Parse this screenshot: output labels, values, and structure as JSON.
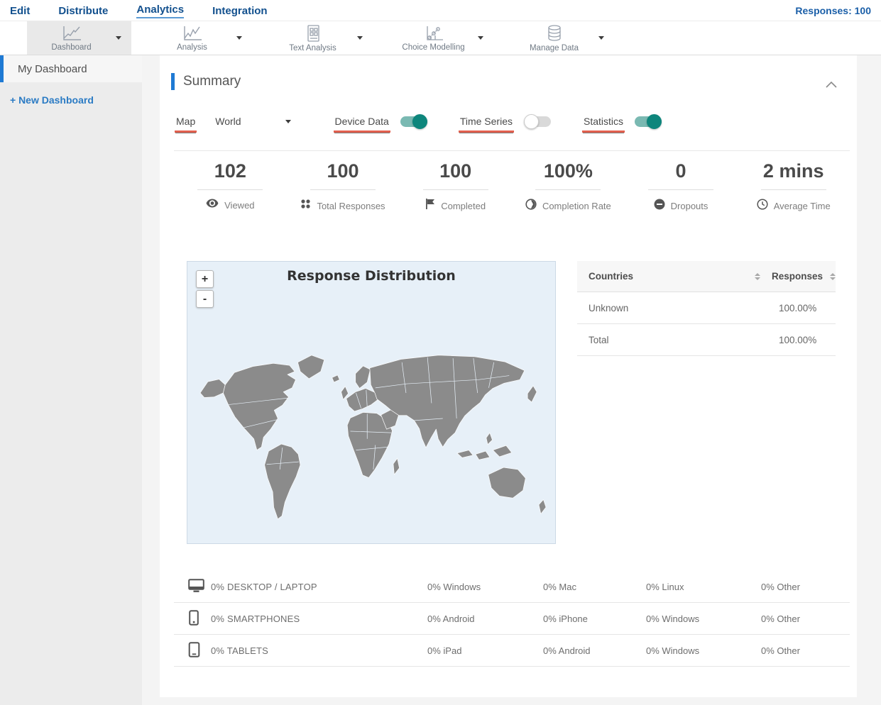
{
  "nav": {
    "items": [
      {
        "label": "Edit",
        "active": false
      },
      {
        "label": "Distribute",
        "active": false
      },
      {
        "label": "Analytics",
        "active": true
      },
      {
        "label": "Integration",
        "active": false
      }
    ],
    "responses_label": "Responses: 100"
  },
  "toolbar": {
    "items": [
      {
        "label": "Dashboard",
        "icon": "line-chart-icon",
        "selected": true
      },
      {
        "label": "Analysis",
        "icon": "line-chart-icon",
        "selected": false
      },
      {
        "label": "Text Analysis",
        "icon": "document-grid-icon",
        "selected": false
      },
      {
        "label": "Choice Modelling",
        "icon": "scatter-chart-icon",
        "selected": false
      },
      {
        "label": "Manage Data",
        "icon": "database-icon",
        "selected": false
      }
    ]
  },
  "sidebar": {
    "selected_item": "My Dashboard",
    "new_dashboard_label": "+ New Dashboard"
  },
  "summary": {
    "title": "Summary",
    "controls": {
      "map_label": "Map",
      "map_value": "World",
      "device_data_label": "Device Data",
      "device_data_on": true,
      "time_series_label": "Time Series",
      "time_series_on": false,
      "statistics_label": "Statistics",
      "statistics_on": true
    },
    "stats": [
      {
        "value": "102",
        "label": "Viewed",
        "icon": "eye-icon"
      },
      {
        "value": "100",
        "label": "Total Responses",
        "icon": "dots-grid-icon"
      },
      {
        "value": "100",
        "label": "Completed",
        "icon": "flag-icon"
      },
      {
        "value": "100%",
        "label": "Completion Rate",
        "icon": "contrast-icon"
      },
      {
        "value": "0",
        "label": "Dropouts",
        "icon": "minus-circle-icon"
      },
      {
        "value": "2 mins",
        "label": "Average Time",
        "icon": "clock-icon"
      }
    ],
    "map": {
      "title": "Response Distribution",
      "zoom_in": "+",
      "zoom_out": "-"
    },
    "countries_table": {
      "columns": [
        "Countries",
        "Responses"
      ],
      "rows": [
        {
          "name": "Unknown",
          "value": "100.00%"
        },
        {
          "name": "Total",
          "value": "100.00%"
        }
      ]
    },
    "device_table": {
      "rows": [
        {
          "icon": "desktop-icon",
          "category": "0% DESKTOP / LAPTOP",
          "cols": [
            "0% Windows",
            "0% Mac",
            "0% Linux",
            "0% Other"
          ]
        },
        {
          "icon": "smartphone-icon",
          "category": "0% SMARTPHONES",
          "cols": [
            "0% Android",
            "0% iPhone",
            "0% Windows",
            "0% Other"
          ]
        },
        {
          "icon": "tablet-icon",
          "category": "0% TABLETS",
          "cols": [
            "0% iPad",
            "0% Android",
            "0% Windows",
            "0% Other"
          ]
        }
      ]
    }
  },
  "colors": {
    "accent_blue": "#1f7ad4",
    "nav_blue": "#12508e",
    "toggle_on": "#0e867c",
    "underline_red": "#e2604e",
    "map_land": "#8b8b8b",
    "map_sea": "#e7f0f8"
  }
}
